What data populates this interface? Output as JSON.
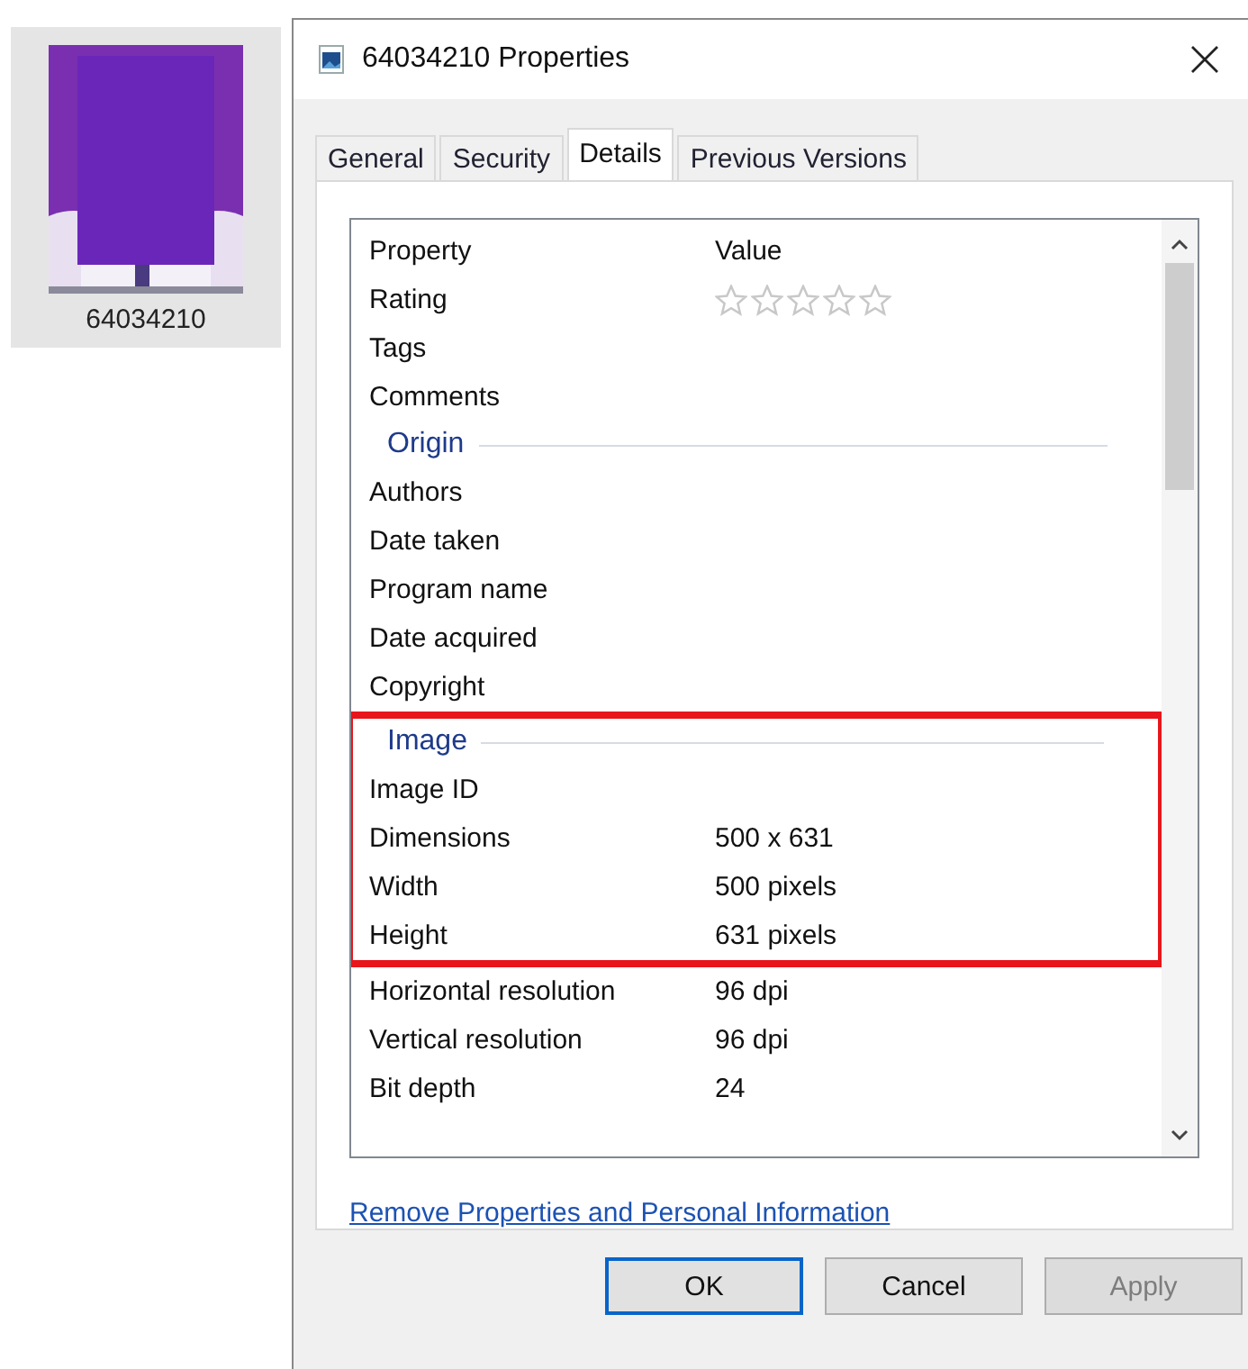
{
  "file_icon": {
    "label": "64034210",
    "selected": true
  },
  "window": {
    "title": "64034210 Properties"
  },
  "tabs": [
    {
      "label": "General",
      "selected": false
    },
    {
      "label": "Security",
      "selected": false
    },
    {
      "label": "Details",
      "selected": true
    },
    {
      "label": "Previous Versions",
      "selected": false
    }
  ],
  "details": {
    "columns": [
      "Property",
      "Value"
    ],
    "sections": [
      {
        "highlighted": false,
        "rows": [
          {
            "name": "Rating",
            "stars": 0
          },
          {
            "name": "Tags"
          },
          {
            "name": "Comments"
          }
        ]
      },
      {
        "heading": "Origin",
        "highlighted": false,
        "rows": [
          {
            "name": "Authors"
          },
          {
            "name": "Date taken"
          },
          {
            "name": "Program name"
          },
          {
            "name": "Date acquired"
          },
          {
            "name": "Copyright"
          }
        ]
      },
      {
        "heading": "Image",
        "highlighted": true,
        "rows": [
          {
            "name": "Image ID"
          },
          {
            "name": "Dimensions",
            "value": "500 x 631"
          },
          {
            "name": "Width",
            "value": "500 pixels"
          },
          {
            "name": "Height",
            "value": "631 pixels"
          }
        ]
      },
      {
        "highlighted": false,
        "rows": [
          {
            "name": "Horizontal resolution",
            "value": "96 dpi"
          },
          {
            "name": "Vertical resolution",
            "value": "96 dpi"
          },
          {
            "name": "Bit depth",
            "value": "24"
          }
        ]
      }
    ]
  },
  "link": "Remove Properties and Personal Information",
  "buttons": [
    {
      "label": "OK",
      "disabled": false,
      "default": true
    },
    {
      "label": "Cancel",
      "disabled": false,
      "default": false
    },
    {
      "label": "Apply",
      "disabled": true,
      "default": false
    }
  ]
}
